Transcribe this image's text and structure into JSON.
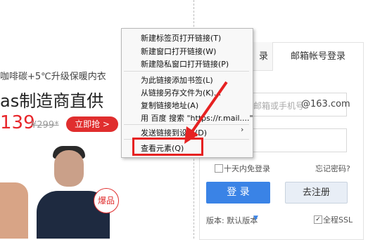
{
  "promo": {
    "subtitle": "咖啡碳+5℃升级保暖内衣",
    "title": "as制造商直供",
    "price": "139",
    "old_price": "¥299*",
    "buy_label": "立即抢 >",
    "hot_badge": "爆品"
  },
  "login": {
    "tab_left": "录",
    "tab_right": "邮箱帐号登录",
    "username_placeholder": "邮箱或手机号",
    "domain_suffix": "@163.com",
    "remember_label": "十天内免登录",
    "forgot_label": "忘记密码?",
    "login_button": "登 录",
    "register_button": "去注册",
    "version_label": "版本: 默认版本",
    "ssl_label": "全程SSL",
    "ssl_checked": "✓"
  },
  "context_menu": {
    "items": [
      "新建标签页打开链接(T)",
      "新建窗口打开链接(W)",
      "新建隐私窗口打开链接(P)",
      "为此链接添加书签(L)",
      "从链接另存文件为(K)...",
      "复制链接地址(A)",
      "用 百度 搜索 \"https://r.mail....\"",
      "发送链接到设备(D)",
      "查看元素(Q)"
    ],
    "submenu_arrow": "›"
  },
  "colors": {
    "highlight": "#e62121",
    "login_blue": "#3a83e6",
    "promo_red": "#e8262b"
  }
}
